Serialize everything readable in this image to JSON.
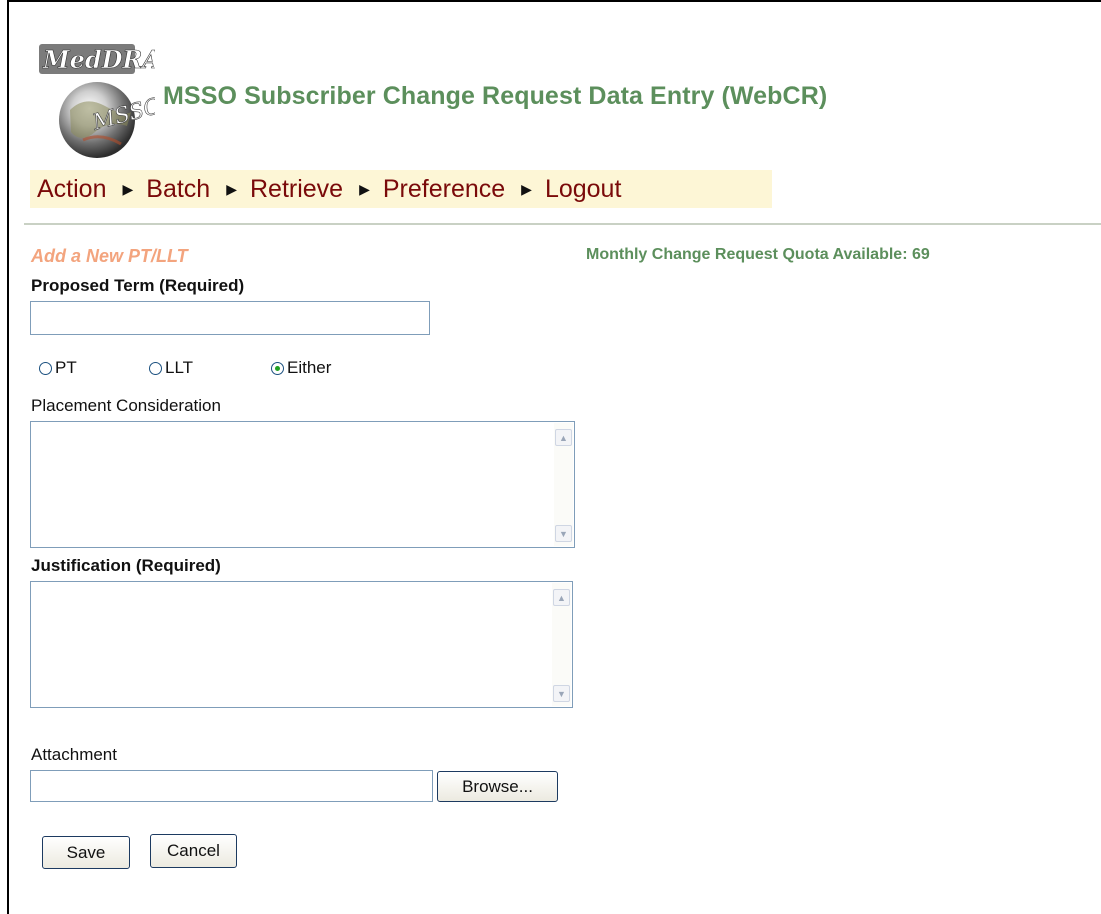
{
  "header": {
    "logo_text": "MedDRA",
    "logo_globe_text": "MSSO",
    "app_title": "MSSO Subscriber Change Request Data Entry (WebCR)"
  },
  "nav": {
    "items": [
      {
        "label": "Action"
      },
      {
        "label": "Batch"
      },
      {
        "label": "Retrieve"
      },
      {
        "label": "Preference"
      },
      {
        "label": "Logout"
      }
    ],
    "separator_icon": "triangle-right-icon"
  },
  "form": {
    "section_title": "Add a New PT/LLT",
    "quota_text": "Monthly Change Request Quota Available: 69",
    "proposed_term_label": "Proposed Term (Required)",
    "proposed_term_value": "",
    "term_type": {
      "options": [
        {
          "label": "PT",
          "checked": false
        },
        {
          "label": "LLT",
          "checked": false
        },
        {
          "label": "Either",
          "checked": true
        }
      ]
    },
    "placement_label": "Placement Consideration",
    "placement_value": "",
    "justification_label": "Justification (Required)",
    "justification_value": "",
    "attachment_label": "Attachment",
    "attachment_value": "",
    "browse_label": "Browse...",
    "save_label": "Save",
    "cancel_label": "Cancel"
  },
  "colors": {
    "title_green": "#5c8f5c",
    "nav_red": "#7a0a0a",
    "nav_bg": "#fdf6d6",
    "section_orange": "#f3a47e"
  }
}
